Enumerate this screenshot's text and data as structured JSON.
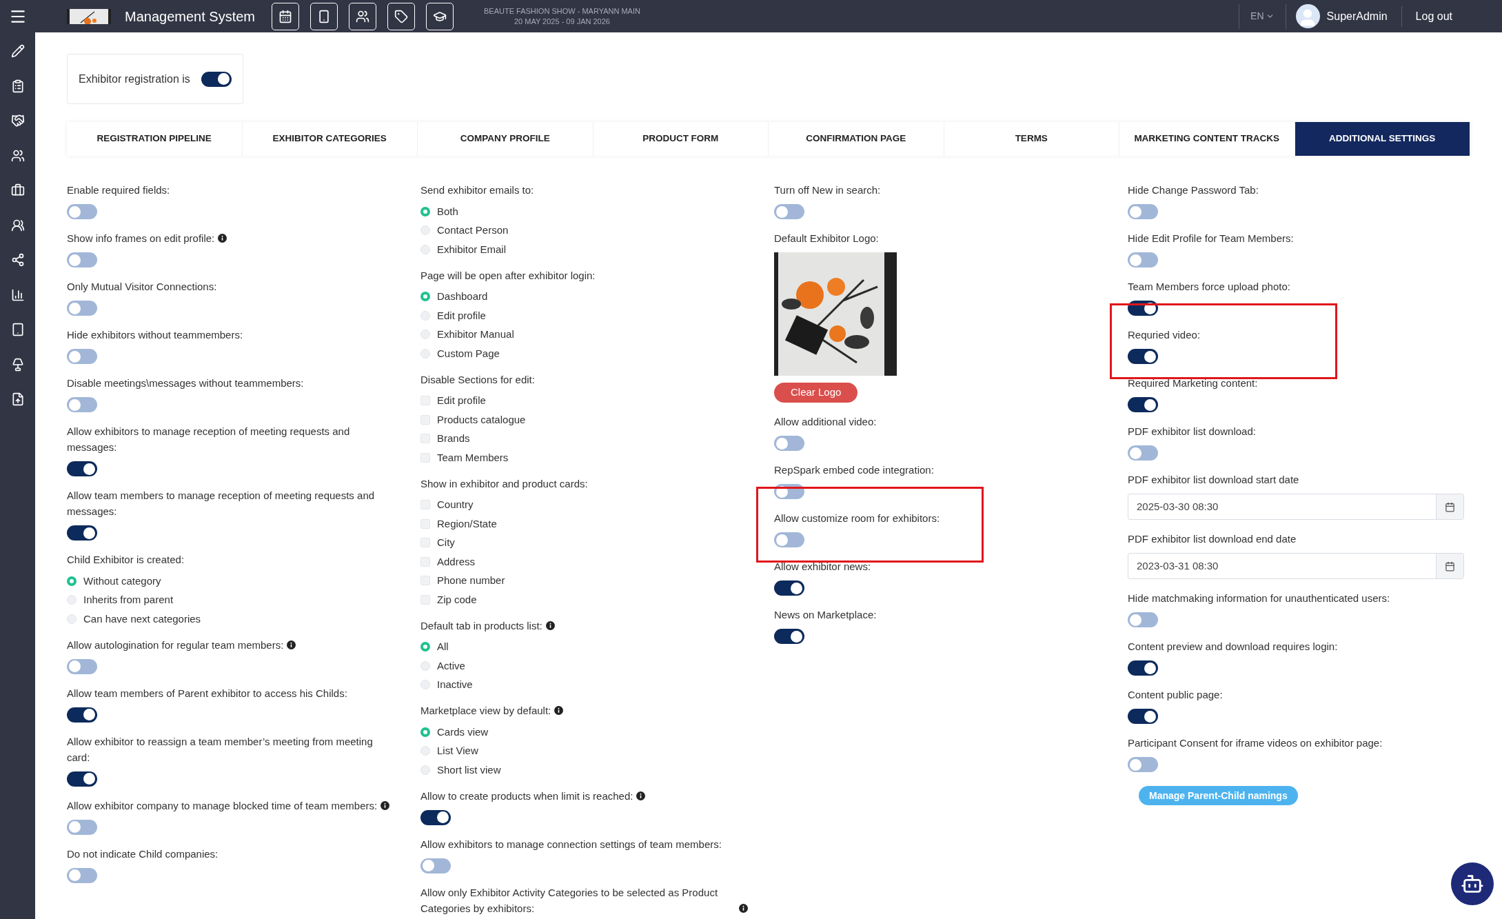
{
  "topbar": {
    "title": "Management System",
    "event_name": "BEAUTE FASHION SHOW - MARYANN MAIN",
    "event_dates": "20 MAY 2025 - 09 JAN 2026",
    "language": "EN",
    "user": "SuperAdmin",
    "logout": "Log out"
  },
  "registration": {
    "label": "Exhibitor registration is",
    "on": true
  },
  "tabs": [
    {
      "label": "REGISTRATION PIPELINE",
      "selected": false
    },
    {
      "label": "EXHIBITOR CATEGORIES",
      "selected": false
    },
    {
      "label": "COMPANY PROFILE",
      "selected": false
    },
    {
      "label": "PRODUCT FORM",
      "selected": false
    },
    {
      "label": "CONFIRMATION PAGE",
      "selected": false
    },
    {
      "label": "TERMS",
      "selected": false
    },
    {
      "label": "MARKETING CONTENT TRACKS",
      "selected": false
    },
    {
      "label": "ADDITIONAL SETTINGS",
      "selected": true
    }
  ],
  "columns": [
    [
      {
        "kind": "toggle",
        "label": "Enable required fields:",
        "info": false,
        "on": false,
        "highlighted": false
      },
      {
        "kind": "toggle",
        "label": "Show info frames on edit profile:",
        "info": true,
        "on": false,
        "highlighted": false
      },
      {
        "kind": "toggle",
        "label": "Only Mutual Visitor Connections:",
        "info": false,
        "on": false,
        "highlighted": false
      },
      {
        "kind": "toggle",
        "label": "Hide exhibitors without teammembers:",
        "info": false,
        "on": false,
        "highlighted": false
      },
      {
        "kind": "toggle",
        "label": "Disable meetings\\messages without teammembers:",
        "info": false,
        "on": false,
        "highlighted": false
      },
      {
        "kind": "toggle",
        "label": "Allow exhibitors to manage reception of meeting requests and messages:",
        "info": false,
        "on": true,
        "highlighted": false
      },
      {
        "kind": "toggle",
        "label": "Allow team members to manage reception of meeting requests and messages:",
        "info": false,
        "on": true,
        "highlighted": false
      },
      {
        "kind": "radio",
        "label": "Child Exhibitor is created:",
        "info": false,
        "options": [
          {
            "label": "Without category",
            "selected": true
          },
          {
            "label": "Inherits from parent",
            "selected": false
          },
          {
            "label": "Can have next categories",
            "selected": false
          }
        ]
      },
      {
        "kind": "toggle",
        "label": "Allow autologination for regular team members:",
        "info": true,
        "on": false,
        "highlighted": false
      },
      {
        "kind": "toggle",
        "label": "Allow team members of Parent exhibitor to access his Childs:",
        "info": false,
        "on": true,
        "highlighted": false
      },
      {
        "kind": "toggle",
        "label": "Allow exhibitor to reassign a team member’s meeting from meeting card:",
        "info": false,
        "on": true,
        "highlighted": false
      },
      {
        "kind": "toggle",
        "label": "Allow exhibitor company to manage blocked time of team members:",
        "info": true,
        "on": false,
        "highlighted": false
      },
      {
        "kind": "toggle",
        "label": "Do not indicate Child companies:",
        "info": false,
        "on": false,
        "highlighted": false
      }
    ],
    [
      {
        "kind": "radio",
        "label": "Send exhibitor emails to:",
        "info": false,
        "options": [
          {
            "label": "Both",
            "selected": true
          },
          {
            "label": "Contact Person",
            "selected": false
          },
          {
            "label": "Exhibitor Email",
            "selected": false
          }
        ]
      },
      {
        "kind": "radio",
        "label": "Page will be open after exhibitor login:",
        "info": false,
        "options": [
          {
            "label": "Dashboard",
            "selected": true
          },
          {
            "label": "Edit profile",
            "selected": false
          },
          {
            "label": "Exhibitor Manual",
            "selected": false
          },
          {
            "label": "Custom Page",
            "selected": false
          }
        ]
      },
      {
        "kind": "checks",
        "label": "Disable Sections for edit:",
        "options": [
          {
            "label": "Edit profile",
            "checked": false
          },
          {
            "label": "Products catalogue",
            "checked": false
          },
          {
            "label": "Brands",
            "checked": false
          },
          {
            "label": "Team Members",
            "checked": false
          }
        ]
      },
      {
        "kind": "checks",
        "label": "Show in exhibitor and product cards:",
        "options": [
          {
            "label": "Country",
            "checked": false
          },
          {
            "label": "Region/State",
            "checked": false
          },
          {
            "label": "City",
            "checked": false
          },
          {
            "label": "Address",
            "checked": false
          },
          {
            "label": "Phone number",
            "checked": false
          },
          {
            "label": "Zip code",
            "checked": false
          }
        ]
      },
      {
        "kind": "radio",
        "label": "Default tab in products list:",
        "info": true,
        "options": [
          {
            "label": "All",
            "selected": true
          },
          {
            "label": "Active",
            "selected": false
          },
          {
            "label": "Inactive",
            "selected": false
          }
        ]
      },
      {
        "kind": "radio",
        "label": "Marketplace view by default:",
        "info": true,
        "options": [
          {
            "label": "Cards view",
            "selected": true
          },
          {
            "label": "List View",
            "selected": false
          },
          {
            "label": "Short list view",
            "selected": false
          }
        ]
      },
      {
        "kind": "toggle",
        "label": "Allow to create products when limit is reached:",
        "info": true,
        "on": true,
        "highlighted": false
      },
      {
        "kind": "toggle",
        "label": "Allow exhibitors to manage connection settings of team members:",
        "info": false,
        "on": false,
        "highlighted": false
      },
      {
        "kind": "label",
        "label": "Allow only Exhibitor Activity Categories to be selected as Product Categories by exhibitors:",
        "info": true
      }
    ],
    [
      {
        "kind": "toggle",
        "label": "Turn off New in search:",
        "info": false,
        "on": false,
        "highlighted": false
      },
      {
        "kind": "logo",
        "label": "Default Exhibitor Logo:",
        "button": "Clear Logo"
      },
      {
        "kind": "toggle",
        "label": "Allow additional video:",
        "info": false,
        "on": false,
        "highlighted": false
      },
      {
        "kind": "toggle",
        "label": "RepSpark embed code integration:",
        "info": false,
        "on": false,
        "highlighted": false
      },
      {
        "kind": "toggle",
        "label": "Allow customize room for exhibitors:",
        "info": false,
        "on": false,
        "highlighted": true
      },
      {
        "kind": "toggle",
        "label": "Allow exhibitor news:",
        "info": false,
        "on": true,
        "highlighted": false
      },
      {
        "kind": "toggle",
        "label": "News on Marketplace:",
        "info": false,
        "on": true,
        "highlighted": false
      }
    ],
    [
      {
        "kind": "toggle",
        "label": "Hide Change Password Tab:",
        "info": false,
        "on": false,
        "highlighted": false
      },
      {
        "kind": "toggle",
        "label": "Hide Edit Profile for Team Members:",
        "info": false,
        "on": false,
        "highlighted": false
      },
      {
        "kind": "toggle",
        "label": "Team Members force upload photo:",
        "info": false,
        "on": true,
        "highlighted": false
      },
      {
        "kind": "toggle",
        "label": "Requried video:",
        "info": false,
        "on": true,
        "highlighted": true
      },
      {
        "kind": "toggle",
        "label": "Required Marketing content:",
        "info": false,
        "on": true,
        "highlighted": false
      },
      {
        "kind": "toggle",
        "label": "PDF exhibitor list download:",
        "info": false,
        "on": false,
        "highlighted": false
      },
      {
        "kind": "date",
        "label": "PDF exhibitor list download start date",
        "value": "2025-03-30 08:30"
      },
      {
        "kind": "date",
        "label": "PDF exhibitor list download end date",
        "value": "2023-03-31 08:30"
      },
      {
        "kind": "toggle",
        "label": "Hide matchmaking information for unauthenticated users:",
        "info": false,
        "on": false,
        "highlighted": false
      },
      {
        "kind": "toggle",
        "label": "Content preview and download requires login:",
        "info": false,
        "on": true,
        "highlighted": false
      },
      {
        "kind": "toggle",
        "label": "Content public page:",
        "info": false,
        "on": true,
        "highlighted": false
      },
      {
        "kind": "toggle",
        "label": "Participant Consent for iframe videos on exhibitor page:",
        "info": false,
        "on": false,
        "highlighted": false
      },
      {
        "kind": "button",
        "label": "Manage Parent-Child namings"
      }
    ]
  ]
}
